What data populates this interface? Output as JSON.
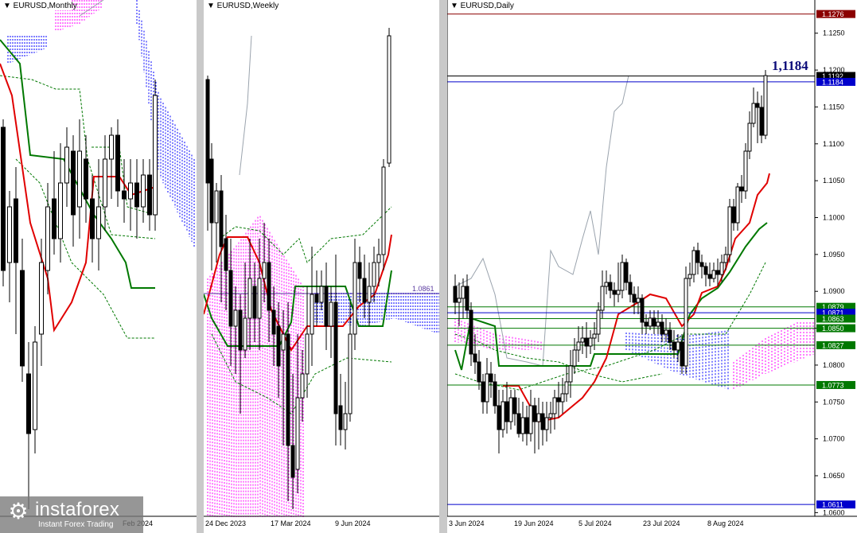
{
  "brand": {
    "name": "instaforex",
    "tagline": "Instant Forex Trading",
    "icon": "gear-logo-icon"
  },
  "colors": {
    "tenkan": "#e00000",
    "kijun": "#007800",
    "cloud_up": "#ff00ff",
    "cloud_down": "#0000ff",
    "chikou": "#9aa3ad",
    "level_blue": "#0000cc",
    "level_red": "#8b0000",
    "level_green": "#007800"
  },
  "chart_data": [
    {
      "type": "candlestick",
      "title": "EURUSD,Monthly",
      "x_tick_labels": [
        "Feb 2024"
      ],
      "series": [
        "tenkan",
        "kijun",
        "chikou",
        "cloud",
        "candles"
      ]
    },
    {
      "type": "candlestick",
      "title": "EURUSD,Weekly",
      "x_tick_labels": [
        "24 Dec 2023",
        "17 Mar 2024",
        "9 Jun 2024"
      ],
      "price_label": "1.0861"
    },
    {
      "type": "candlestick",
      "title": "EURUSD,Daily",
      "x_tick_labels": [
        "3 Jun 2024",
        "19 Jun 2024",
        "5 Jul 2024",
        "23 Jul 2024",
        "8 Aug 2024"
      ],
      "y_ticks": [
        "1.1250",
        "1.1200",
        "1.1150",
        "1.1100",
        "1.1050",
        "1.1000",
        "1.0950",
        "1.0900",
        "1.0850",
        "1.0800",
        "1.0750",
        "1.0700",
        "1.0650",
        "1.0600"
      ],
      "ylim": [
        1.0595,
        1.1295
      ],
      "annotation": "1,1184",
      "levels": [
        {
          "label": "1.1276",
          "value": 1.1276,
          "color": "#8b0000"
        },
        {
          "label": "1.1192",
          "value": 1.1192,
          "color": "#000000"
        },
        {
          "label": "1.1184",
          "value": 1.1184,
          "color": "#0000cc"
        },
        {
          "label": "1.0879",
          "value": 1.0879,
          "color": "#007800"
        },
        {
          "label": "1.0871",
          "value": 1.0871,
          "color": "#0000cc"
        },
        {
          "label": "1.0863",
          "value": 1.0863,
          "color": "#007800"
        },
        {
          "label": "1.0850",
          "value": 1.085,
          "color": "#007800"
        },
        {
          "label": "1.0827",
          "value": 1.0827,
          "color": "#007800"
        },
        {
          "label": "1.0773",
          "value": 1.0773,
          "color": "#007800"
        },
        {
          "label": "1.0611",
          "value": 1.0611,
          "color": "#0000cc"
        }
      ]
    }
  ]
}
